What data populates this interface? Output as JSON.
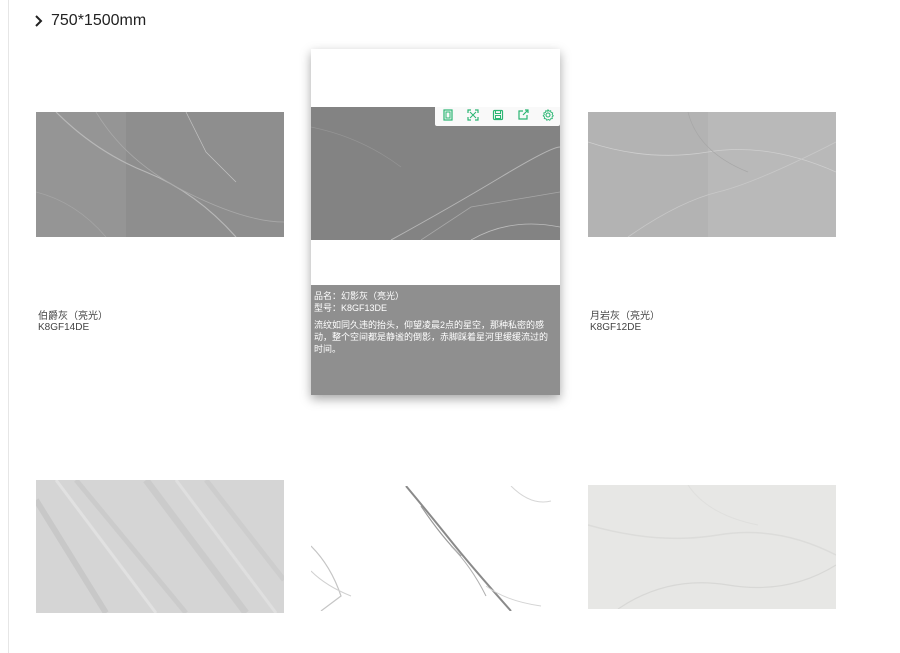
{
  "section": {
    "title": "750*1500mm"
  },
  "toolbar": {
    "icons": [
      "copy-icon",
      "expand-icon",
      "save-icon",
      "share-icon",
      "settings-icon"
    ],
    "accent": "#2bb673"
  },
  "tiles": [
    {
      "name": "伯爵灰（亮光）",
      "code": "K8GF14DE"
    },
    {
      "name_label": "品名：",
      "name": "幻影灰（亮光）",
      "code_label": "型号：",
      "code": "K8GF13DE",
      "description": "流纹如同久违的抬头，仰望凌晨2点的星空，那种私密的感动，整个空间都是静谧的倒影，赤脚踩着星河里缓缓流过的时间。"
    },
    {
      "name": "月岩灰（亮光）",
      "code": "K8GF12DE"
    },
    {
      "name": "",
      "code": ""
    },
    {
      "name": "",
      "code": ""
    },
    {
      "name": "",
      "code": ""
    }
  ],
  "colors": {
    "panel": "#8f8f8f",
    "accent": "#2bb673"
  }
}
